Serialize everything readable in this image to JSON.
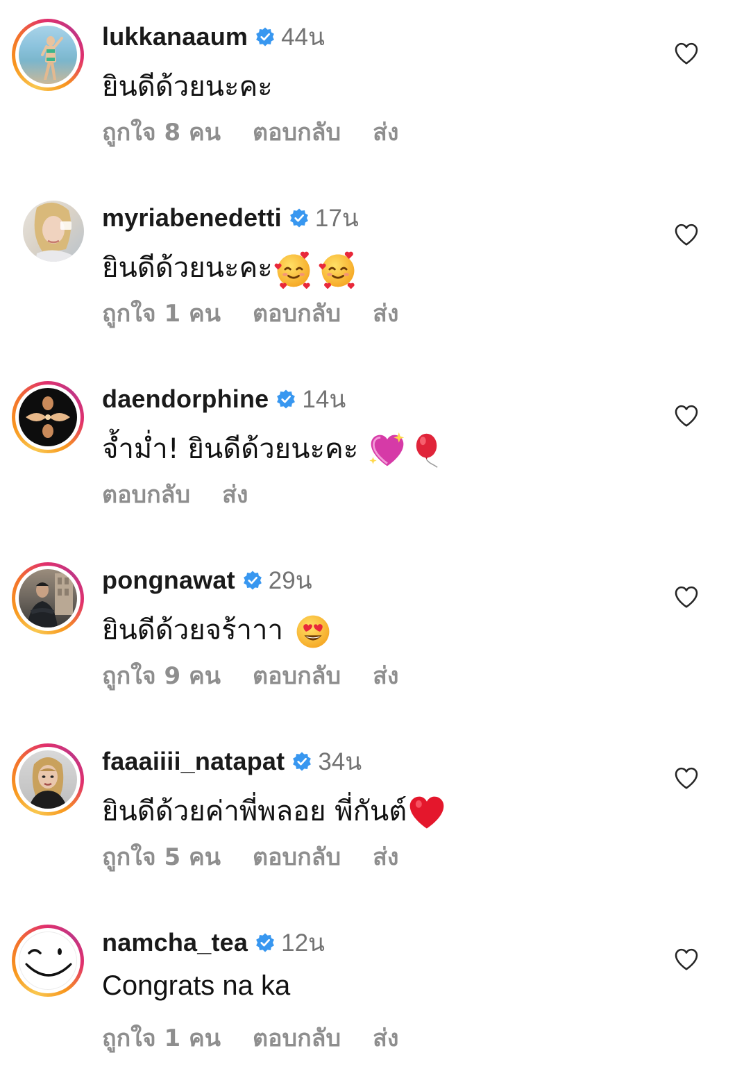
{
  "comments": [
    {
      "username": "lukkanaaum",
      "time": "44น",
      "text": "ยินดีด้วยนะคะ",
      "emojis": [],
      "likes": "ถูกใจ 8 คน",
      "reply": "ตอบกลับ",
      "send": "ส่ง"
    },
    {
      "username": "myriabenedetti",
      "time": "17น",
      "text": "ยินดีด้วยนะคะ",
      "emojis": [
        "smiling-face-with-hearts",
        "smiling-face-with-hearts"
      ],
      "likes": "ถูกใจ 1 คน",
      "reply": "ตอบกลับ",
      "send": "ส่ง"
    },
    {
      "username": "daendorphine",
      "time": "14น",
      "text": "จ้ำม่ำ! ยินดีด้วยนะคะ",
      "emojis": [
        "sparkling-heart",
        "red-balloon"
      ],
      "likes": "",
      "reply": "ตอบกลับ",
      "send": "ส่ง"
    },
    {
      "username": "pongnawat",
      "time": "29น",
      "text": "ยินดีด้วยจร้าาา",
      "emojis": [
        "heart-eyes"
      ],
      "likes": "ถูกใจ 9 คน",
      "reply": "ตอบกลับ",
      "send": "ส่ง"
    },
    {
      "username": "faaaiiii_natapat",
      "time": "34น",
      "text": "ยินดีด้วยค่าพี่พลอย พี่กันต์",
      "emojis": [
        "red-heart"
      ],
      "likes": "ถูกใจ 5 คน",
      "reply": "ตอบกลับ",
      "send": "ส่ง"
    },
    {
      "username": "namcha_tea",
      "time": "12น",
      "text": "Congrats na ka",
      "emojis": [],
      "likes": "ถูกใจ 1 คน",
      "reply": "ตอบกลับ",
      "send": "ส่ง"
    }
  ],
  "colors": {
    "verified_blue": "#3897f0",
    "muted_gray": "#8e8e8e",
    "timestamp_gray": "#737373"
  }
}
